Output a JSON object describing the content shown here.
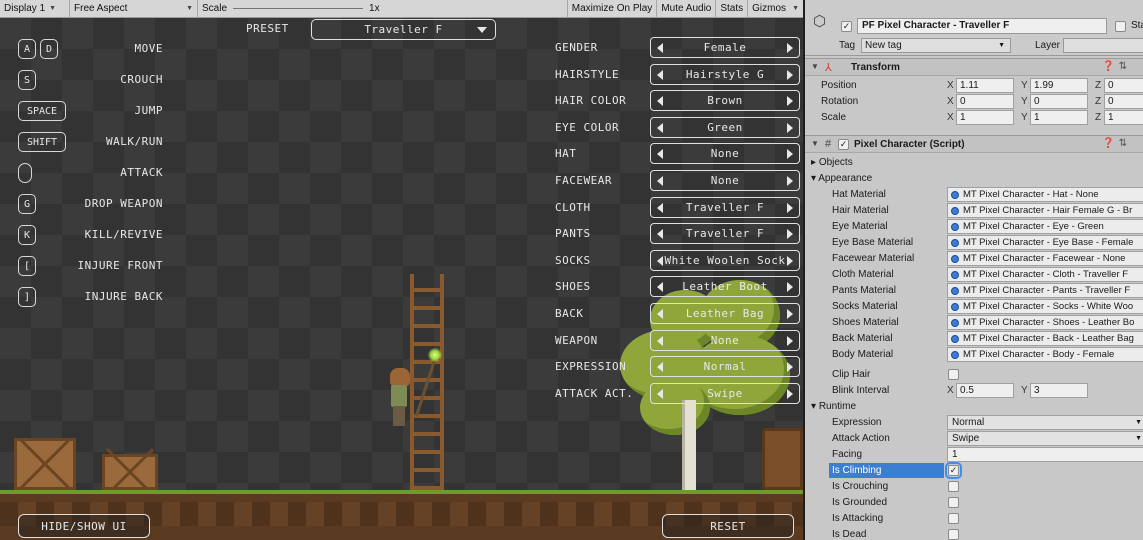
{
  "game_toolbar": {
    "display": "Display 1",
    "aspect": "Free Aspect",
    "scale_label": "Scale",
    "scale_value": "1x",
    "maximize": "Maximize On Play",
    "mute": "Mute Audio",
    "stats": "Stats",
    "gizmos": "Gizmos"
  },
  "controls": [
    {
      "keys": [
        "A",
        "D"
      ],
      "label": "MOVE"
    },
    {
      "keys": [
        "S"
      ],
      "label": "CROUCH"
    },
    {
      "keys": [
        "SPACE"
      ],
      "label": "JUMP"
    },
    {
      "keys": [
        "SHIFT"
      ],
      "label": "WALK/RUN"
    },
    {
      "keys": [
        "mouse-icon"
      ],
      "label": "ATTACK"
    },
    {
      "keys": [
        "G"
      ],
      "label": "DROP WEAPON"
    },
    {
      "keys": [
        "K"
      ],
      "label": "KILL/REVIVE"
    },
    {
      "keys": [
        "["
      ],
      "label": "INJURE FRONT"
    },
    {
      "keys": [
        "]"
      ],
      "label": "INJURE BACK"
    }
  ],
  "preset": {
    "label": "PRESET",
    "value": "Traveller F"
  },
  "appearance": [
    {
      "label": "GENDER",
      "value": "Female"
    },
    {
      "label": "HAIRSTYLE",
      "value": "Hairstyle G"
    },
    {
      "label": "HAIR COLOR",
      "value": "Brown"
    },
    {
      "label": "EYE COLOR",
      "value": "Green"
    },
    {
      "label": "HAT",
      "value": "None"
    },
    {
      "label": "FACEWEAR",
      "value": "None"
    },
    {
      "label": "CLOTH",
      "value": "Traveller F"
    },
    {
      "label": "PANTS",
      "value": "Traveller F"
    },
    {
      "label": "SOCKS",
      "value": "White Woolen Sock"
    },
    {
      "label": "SHOES",
      "value": "Leather Boot"
    },
    {
      "label": "BACK",
      "value": "Leather Bag"
    },
    {
      "label": "WEAPON",
      "value": "None"
    },
    {
      "label": "EXPRESSION",
      "value": "Normal"
    },
    {
      "label": "ATTACK ACT.",
      "value": "Swipe"
    }
  ],
  "buttons": {
    "hide_show": "HIDE/SHOW UI",
    "reset": "RESET"
  },
  "inspector": {
    "object_name": "PF Pixel Character - Traveller F",
    "static": "Static",
    "tag_label": "Tag",
    "tag_value": "New tag",
    "layer_label": "Layer",
    "transform": {
      "title": "Transform",
      "rows": [
        {
          "label": "Position",
          "x": "1.11",
          "y": "1.99",
          "z": "0"
        },
        {
          "label": "Rotation",
          "x": "0",
          "y": "0",
          "z": "0"
        },
        {
          "label": "Scale",
          "x": "1",
          "y": "1",
          "z": "1"
        }
      ]
    },
    "script": {
      "title": "Pixel Character (Script)",
      "objects": "Objects",
      "appearance": "Appearance",
      "materials": [
        {
          "label": "Hat Material",
          "value": "MT Pixel Character - Hat - None"
        },
        {
          "label": "Hair Material",
          "value": "MT Pixel Character - Hair Female G - Br"
        },
        {
          "label": "Eye Material",
          "value": "MT Pixel Character - Eye - Green"
        },
        {
          "label": "Eye Base Material",
          "value": "MT Pixel Character - Eye Base - Female"
        },
        {
          "label": "Facewear Material",
          "value": "MT Pixel Character - Facewear - None"
        },
        {
          "label": "Cloth Material",
          "value": "MT Pixel Character - Cloth - Traveller F"
        },
        {
          "label": "Pants Material",
          "value": "MT Pixel Character - Pants - Traveller F"
        },
        {
          "label": "Socks Material",
          "value": "MT Pixel Character - Socks - White Woo"
        },
        {
          "label": "Shoes Material",
          "value": "MT Pixel Character - Shoes - Leather Bo"
        },
        {
          "label": "Back Material",
          "value": "MT Pixel Character - Back - Leather Bag"
        },
        {
          "label": "Body Material",
          "value": "MT Pixel Character - Body - Female"
        }
      ],
      "clip_hair": "Clip Hair",
      "blink_interval": {
        "label": "Blink Interval",
        "x": "0.5",
        "y": "3"
      },
      "runtime": "Runtime",
      "expression": {
        "label": "Expression",
        "value": "Normal"
      },
      "attack_action": {
        "label": "Attack Action",
        "value": "Swipe"
      },
      "facing": {
        "label": "Facing",
        "value": "1"
      },
      "is_climbing": "Is Climbing",
      "is_crouching": "Is Crouching",
      "is_grounded": "Is Grounded",
      "is_attacking": "Is Attacking",
      "is_dead": "Is Dead"
    }
  },
  "colors": {
    "highlight": "#3c7fd1",
    "game_text": "#e8e8e8",
    "inspector_bg": "#c8c8c8"
  }
}
